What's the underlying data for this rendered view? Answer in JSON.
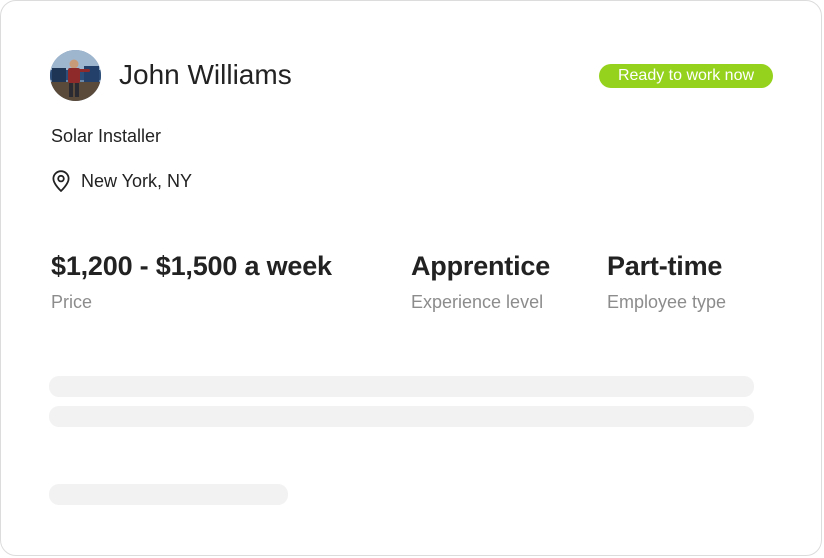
{
  "profile": {
    "name": "John Williams",
    "role": "Solar Installer",
    "location": "New York, NY",
    "avatar_icon": "user-photo"
  },
  "status": {
    "label": "Ready to work now",
    "color": "#95d21d"
  },
  "stats": [
    {
      "value": "$1,200 - $1,500 a week",
      "label": "Price"
    },
    {
      "value": "Apprentice",
      "label": "Experience level"
    },
    {
      "value": "Part-time",
      "label": "Employee type"
    }
  ],
  "icons": {
    "location": "map-pin-icon"
  },
  "colors": {
    "skeleton": "#f2f2f2",
    "muted_text": "#8c8c8c",
    "primary_text": "#222222"
  }
}
